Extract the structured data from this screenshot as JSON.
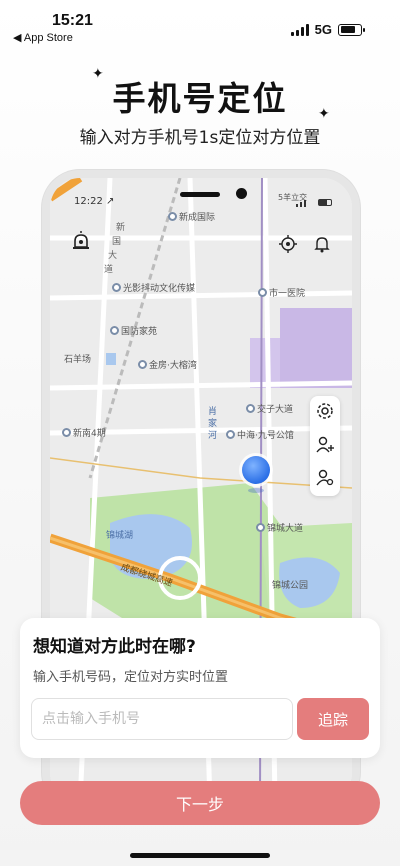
{
  "status_bar": {
    "time": "15:21",
    "back_label": "◀ App Store",
    "network": "5G"
  },
  "header": {
    "title": "手机号定位",
    "subtitle": "输入对方手机号1s定位对方位置"
  },
  "phone_mock": {
    "time": "12:22 ↗",
    "status_text": "5羊立交",
    "map_labels": {
      "xinxin": "新成国际",
      "road_1": "新",
      "road_2": "国",
      "road_3": "大",
      "road_4": "道",
      "media": "光影抖动文化传媒",
      "hospital": "市一医院",
      "guofang": "国防家苑",
      "shiyang": "石羊场",
      "jinfang": "金房·大榕湾",
      "jiaozi": "交子大道",
      "xinnan": "新南4期",
      "zhonghai": "中海·九号公馆",
      "xiaojiahe": "肖家河",
      "jincheng_ave": "锦城大道",
      "jincheng_lake": "锦城湖",
      "ring_road": "成都绕城高速",
      "jincheng_park": "锦城公园"
    }
  },
  "card": {
    "title": "想知道对方此时在哪?",
    "subtitle": "输入手机号码，定位对方实时位置",
    "input_placeholder": "点击输入手机号",
    "track_label": "追踪"
  },
  "footer": {
    "next_label": "下一步"
  },
  "colors": {
    "accent": "#e47d7d",
    "map_purple": "#c9b8e6",
    "map_green": "#bfe3a8",
    "map_water": "#a9c8ee",
    "map_highway": "#f0a23a"
  }
}
